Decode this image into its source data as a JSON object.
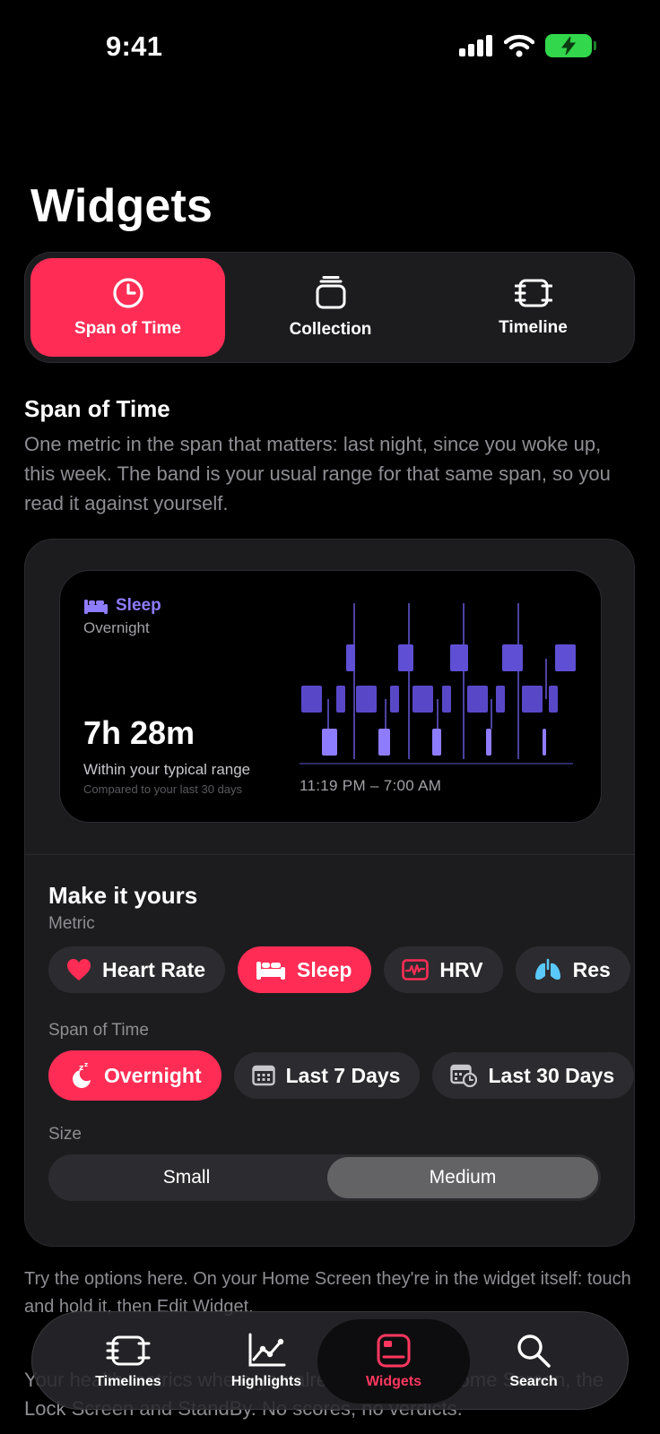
{
  "status": {
    "time": "9:41"
  },
  "page_title": "Widgets",
  "modes": [
    {
      "label": "Span of Time",
      "icon": "clock-icon",
      "active": true
    },
    {
      "label": "Collection",
      "icon": "stack-icon",
      "active": false
    },
    {
      "label": "Timeline",
      "icon": "timeline-icon",
      "active": false
    }
  ],
  "section": {
    "heading": "Span of Time",
    "description": "One metric in the span that matters: last night, since you woke up, this week. The band is your usual range for that same span, so you read it against yourself."
  },
  "preview": {
    "metric": "Sleep",
    "span": "Overnight",
    "value": "7h 28m",
    "status": "Within your typical range",
    "comparison": "Compared to your last 30 days",
    "time_range": "11:19 PM – 7:00 AM"
  },
  "customize": {
    "title": "Make it yours",
    "metric_label": "Metric",
    "metrics": [
      {
        "label": "Heart Rate",
        "icon": "heart-icon",
        "active": false
      },
      {
        "label": "Sleep",
        "icon": "bed-icon",
        "active": true
      },
      {
        "label": "HRV",
        "icon": "waveform-icon",
        "active": false
      },
      {
        "label": "Res",
        "icon": "lungs-icon",
        "active": false
      }
    ],
    "span_label": "Span of Time",
    "spans": [
      {
        "label": "Overnight",
        "icon": "moon-zzz-icon",
        "active": true
      },
      {
        "label": "Last 7 Days",
        "icon": "calendar-icon",
        "active": false
      },
      {
        "label": "Last 30 Days",
        "icon": "calendar-clock-icon",
        "active": false
      }
    ],
    "size_label": "Size",
    "sizes": [
      {
        "label": "Small",
        "active": false
      },
      {
        "label": "Medium",
        "active": true
      }
    ]
  },
  "hint": "Try the options here. On your Home Screen they're in the widget itself: touch and hold it, then Edit Widget.",
  "footer_text": "Your health metrics where you already look: the Home Screen, the Lock Screen and StandBy. No scores, no verdicts.",
  "tabs": [
    {
      "label": "Timelines",
      "icon": "timelines-icon",
      "active": false
    },
    {
      "label": "Highlights",
      "icon": "chart-icon",
      "active": false
    },
    {
      "label": "Widgets",
      "icon": "widget-icon",
      "active": true
    },
    {
      "label": "Search",
      "icon": "search-icon",
      "active": false
    }
  ],
  "colors": {
    "accent": "#ff2d55",
    "sleep": "#8e7cff",
    "background": "#000000",
    "card": "#1c1c1f"
  }
}
